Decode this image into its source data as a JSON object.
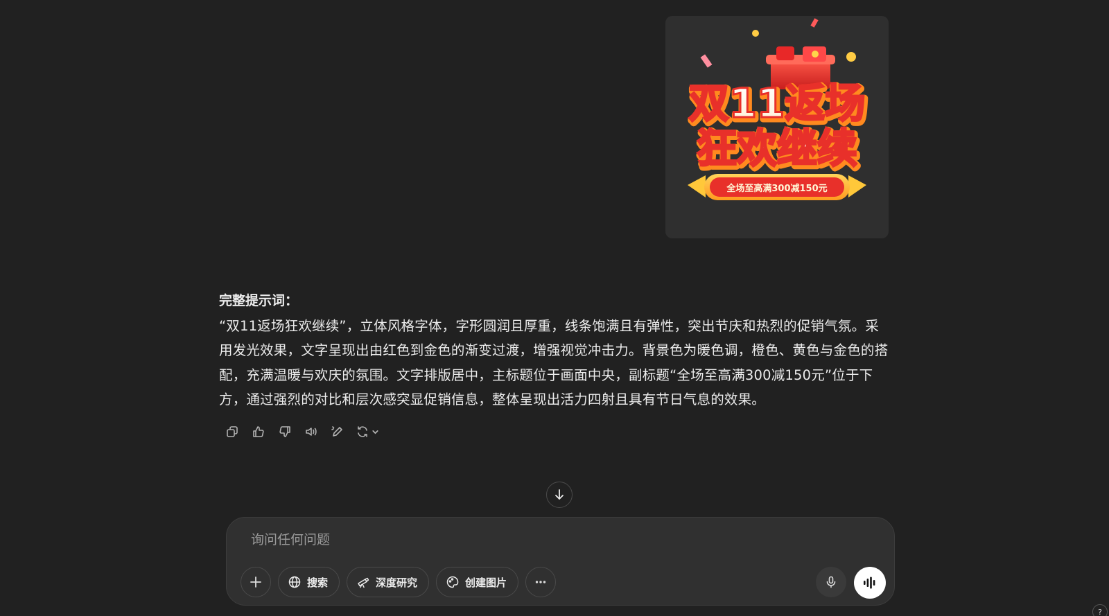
{
  "generated_image": {
    "title_line1": "双11返场",
    "title_line2": "狂欢继续",
    "subtitle": "全场至高满300减150元",
    "colors": {
      "primary_red": "#e8302a",
      "gold": "#ffc83a",
      "orange": "#ff8a1f"
    }
  },
  "message": {
    "heading": "完整提示词：",
    "body": "“双11返场狂欢继续”，立体风格字体，字形圆润且厚重，线条饱满且有弹性，突出节庆和热烈的促销气氛。采用发光效果，文字呈现出由红色到金色的渐变过渡，增强视觉冲击力。背景色为暖色调，橙色、黄色与金色的搭配，充满温暖与欢庆的氛围。文字排版居中，主标题位于画面中央，副标题“全场至高满300减150元”位于下方，通过强烈的对比和层次感突显促销信息，整体呈现出活力四射且具有节日气息的效果。"
  },
  "actions": {
    "icons": [
      "copy-icon",
      "thumbs-up-icon",
      "thumbs-down-icon",
      "read-aloud-icon",
      "edit-icon",
      "regenerate-icon",
      "chevron-down-icon"
    ]
  },
  "composer": {
    "placeholder": "询问任何问题",
    "tools": {
      "search_label": "搜索",
      "deep_research_label": "深度研究",
      "create_image_label": "创建图片"
    }
  },
  "help": {
    "label": "?"
  }
}
